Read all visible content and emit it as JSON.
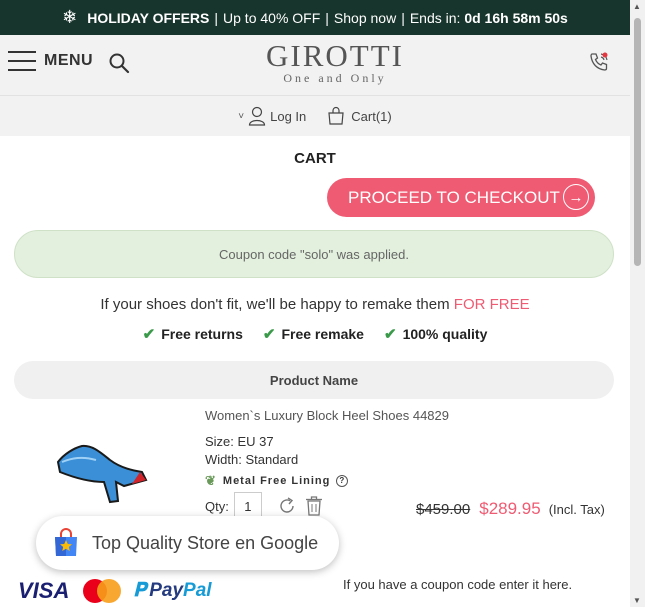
{
  "promo": {
    "icon": "snowflake-icon",
    "title": "HOLIDAY OFFERS",
    "discount": "Up to 40% OFF",
    "shop": "Shop now",
    "ends_label": "Ends in:",
    "countdown": "0d 16h 58m 50s"
  },
  "header": {
    "menu_label": "MENU",
    "logo_name": "GIROTTI",
    "logo_tagline": "One and Only"
  },
  "subnav": {
    "login_label": "Log In",
    "cart_label": "Cart(1)"
  },
  "cart": {
    "title": "CART",
    "checkout_label": "PROCEED TO CHECKOUT",
    "coupon_message": "Coupon code \"solo\" was applied.",
    "remake_text": "If your shoes don't fit, we'll be happy to remake them",
    "remake_highlight": "FOR FREE",
    "perks": [
      "Free returns",
      "Free remake",
      "100% quality"
    ],
    "table_header": "Product Name"
  },
  "product": {
    "name": "Women`s Luxury Block Heel Shoes 44829",
    "size": "Size: EU 37",
    "width": "Width: Standard",
    "lining": "Metal Free Lining",
    "qty_label": "Qty:",
    "qty_value": "1",
    "old_price": "$459.00",
    "new_price": "$289.95",
    "tax_note": "(Incl. Tax)"
  },
  "badge": {
    "text": "Top Quality Store en Google"
  },
  "payments": {
    "visa": "VISA",
    "paypal_a": "Pay",
    "paypal_b": "Pal"
  },
  "footer": {
    "coupon_hint": "If you have a coupon code enter it here."
  },
  "colors": {
    "promo_bg": "#17352c",
    "accent": "#ef5b72",
    "success_bg": "#e2f0dd"
  }
}
